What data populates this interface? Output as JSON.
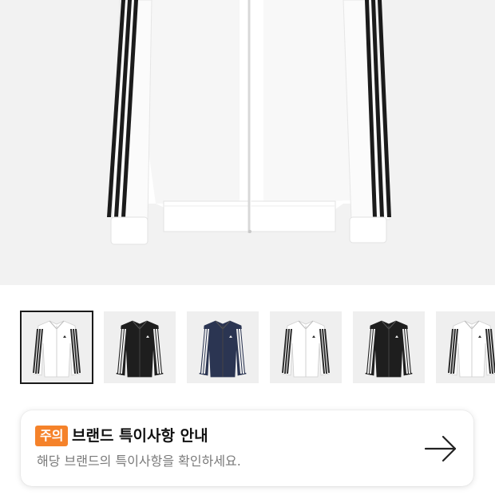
{
  "product": {
    "main_image": "white-track-jacket-black-stripes",
    "thumbnails": [
      {
        "name": "white-jacket-black-stripes",
        "body": "#ffffff",
        "stripe": "#2a2a2a",
        "selected": true
      },
      {
        "name": "black-jacket-white-stripes",
        "body": "#1e1e1e",
        "stripe": "#f0f0f0",
        "selected": false
      },
      {
        "name": "navy-jacket-white-stripes",
        "body": "#2b3552",
        "stripe": "#f0f0f0",
        "selected": false
      },
      {
        "name": "white-jacket-black-stripes",
        "body": "#ffffff",
        "stripe": "#2a2a2a",
        "selected": false
      },
      {
        "name": "black-jacket-white-stripes",
        "body": "#1e1e1e",
        "stripe": "#f0f0f0",
        "selected": false
      },
      {
        "name": "white-jacket-black-stripes",
        "body": "#ffffff",
        "stripe": "#2a2a2a",
        "selected": false
      }
    ]
  },
  "notice": {
    "badge": "주의",
    "title": "브랜드 특이사항 안내",
    "description": "해당 브랜드의 특이사항을 확인하세요.",
    "arrow_icon": "arrow-right-icon",
    "badge_color": "#f5822a"
  }
}
